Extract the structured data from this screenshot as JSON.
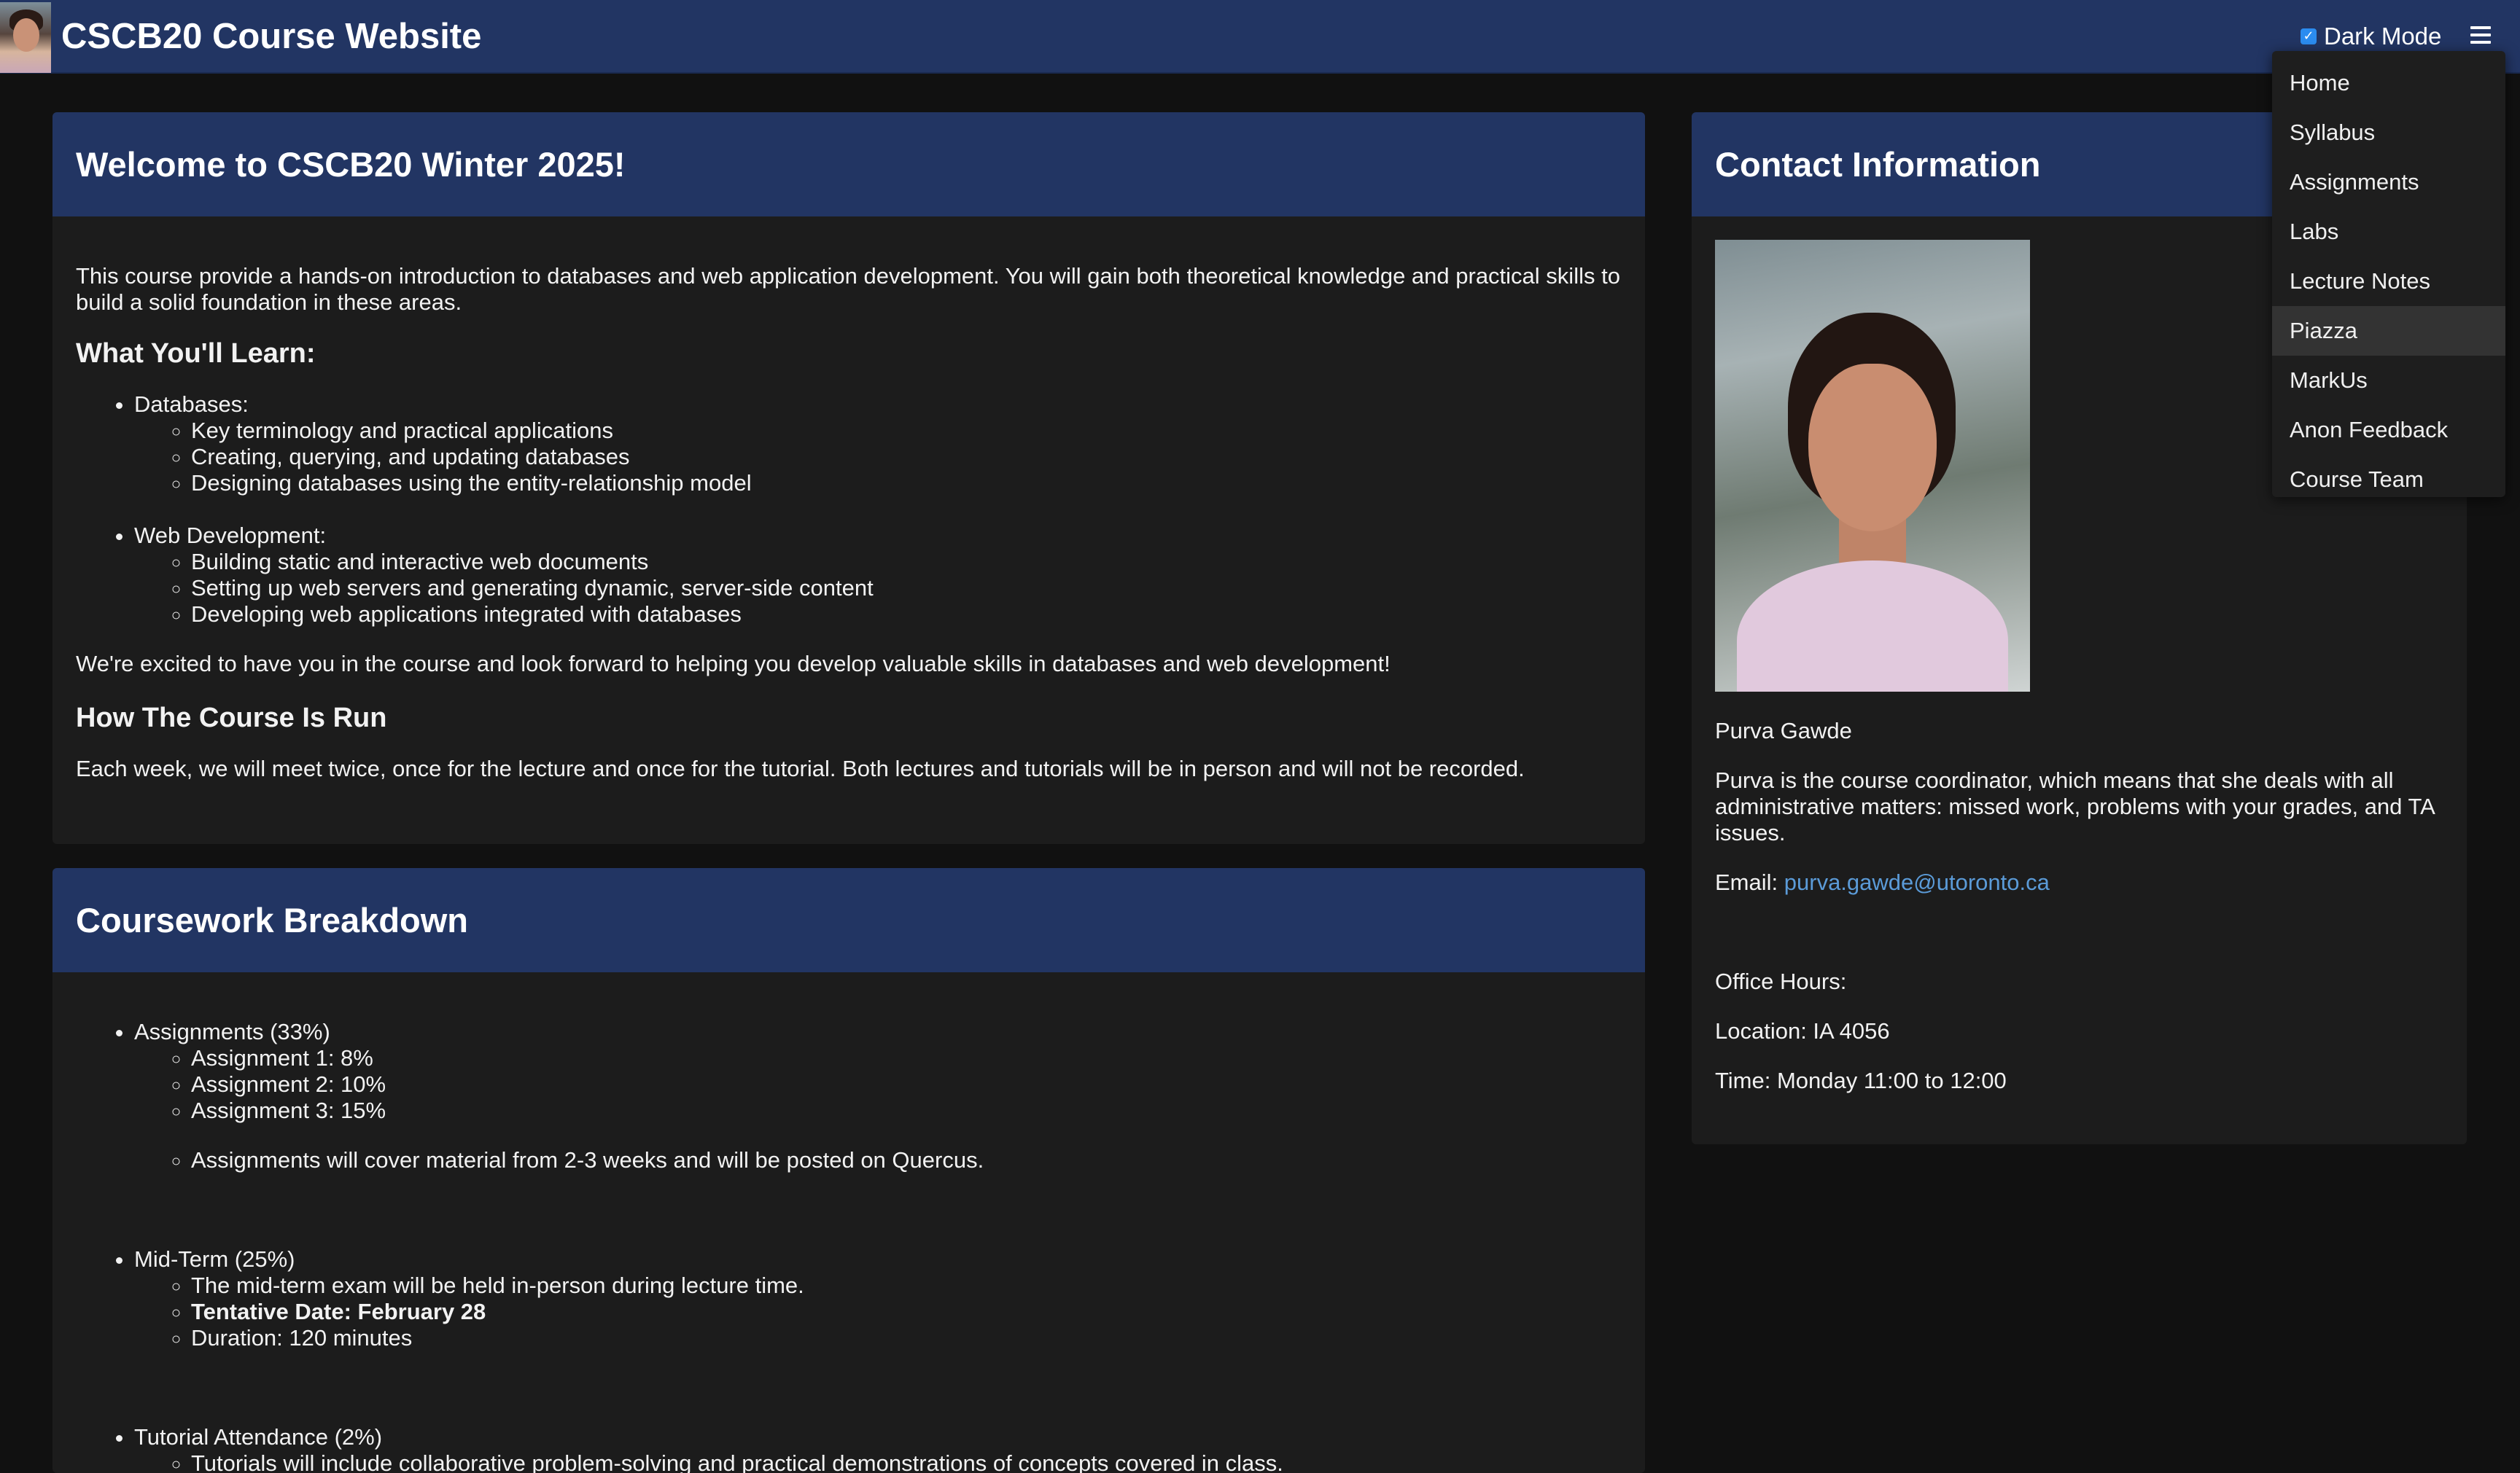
{
  "header": {
    "title": "CSCB20 Course Website",
    "dark_mode_label": "Dark Mode",
    "dark_mode_checked": true
  },
  "menu": {
    "items": [
      {
        "label": "Home"
      },
      {
        "label": "Syllabus"
      },
      {
        "label": "Assignments"
      },
      {
        "label": "Labs"
      },
      {
        "label": "Lecture Notes"
      },
      {
        "label": "Piazza",
        "hovered": true
      },
      {
        "label": "MarkUs"
      },
      {
        "label": "Anon Feedback"
      },
      {
        "label": "Course Team"
      }
    ]
  },
  "welcome": {
    "title": "Welcome to CSCB20 Winter 2025!",
    "intro": "This course provide a hands-on introduction to databases and web application development. You will gain both theoretical knowledge and practical skills to build a solid foundation in these areas.",
    "learn_heading": "What You'll Learn:",
    "topics": [
      {
        "label": "Databases:",
        "items": [
          "Key terminology and practical applications",
          "Creating, querying, and updating databases",
          "Designing databases using the entity-relationship model"
        ]
      },
      {
        "label": "Web Development:",
        "items": [
          "Building static and interactive web documents",
          "Setting up web servers and generating dynamic, server-side content",
          "Developing web applications integrated with databases"
        ]
      }
    ],
    "closing": "We're excited to have you in the course and look forward to helping you develop valuable skills in databases and web development!",
    "run_heading": "How The Course Is Run",
    "run_text": "Each week, we will meet twice, once for the lecture and once for the tutorial. Both lectures and tutorials will be in person and will not be recorded."
  },
  "coursework": {
    "title": "Coursework Breakdown",
    "assignments": {
      "label": "Assignments (33%)",
      "items": [
        "Assignment 1: 8%",
        "Assignment 2: 10%",
        "Assignment 3: 15%"
      ],
      "note": "Assignments will cover material from 2-3 weeks and will be posted on Quercus."
    },
    "midterm": {
      "label": "Mid-Term (25%)",
      "held": "The mid-term exam will be held in-person during lecture time.",
      "date": "Tentative Date: February 28",
      "duration": "Duration: 120 minutes"
    },
    "tutorial": {
      "label": "Tutorial Attendance (2%)",
      "item": "Tutorials will include collaborative problem-solving and practical demonstrations of concepts covered in class."
    }
  },
  "contact": {
    "title": "Contact Information",
    "name": "Purva Gawde",
    "description": "Purva is the course coordinator, which means that she deals with all administrative matters: missed work, problems with your grades, and TA issues.",
    "email_label": "Email:",
    "email": "purva.gawde@utoronto.ca",
    "office_hours_label": "Office Hours:",
    "location": "Location: IA 4056",
    "time": "Time: Monday 11:00 to 12:00"
  }
}
